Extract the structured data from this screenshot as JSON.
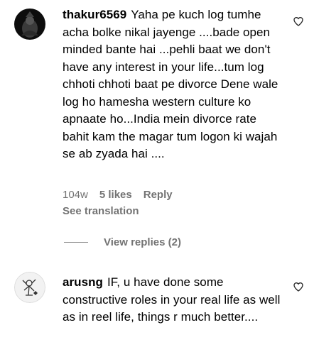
{
  "comments": [
    {
      "username": "thakur6569",
      "text": "Yaha pe kuch log tumhe acha bolke nikal jayenge ....bade open minded bante hai ...pehli baat we don't have any interest in your life...tum log chhoti chhoti baat pe divorce Dene wale log ho hamesha western culture ko apnaate ho...India mein divorce rate bahit kam the magar tum logon ki wajah se ab zyada hai ....",
      "time": "104w",
      "likes": "5 likes",
      "reply_label": "Reply",
      "see_translation": "See translation",
      "view_replies": "View replies (2)"
    },
    {
      "username": "arusng",
      "text": "IF, u have done some constructive roles in your real life as well as in reel life, things r much better...."
    }
  ]
}
